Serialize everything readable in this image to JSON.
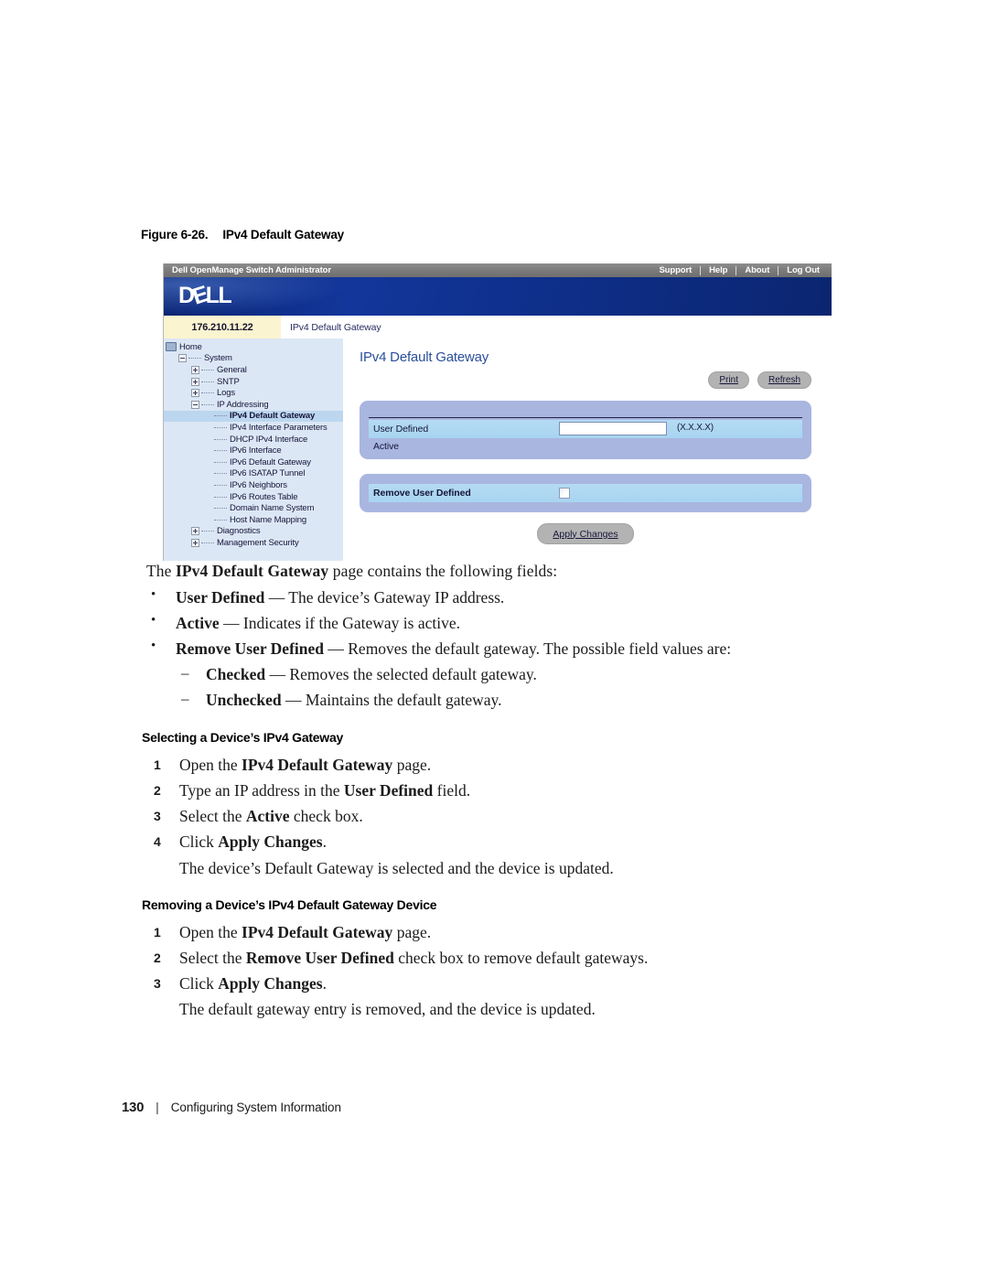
{
  "figure": {
    "number": "Figure 6-26.",
    "title": "IPv4 Default Gateway"
  },
  "screenshot": {
    "titlebar": {
      "app_title": "Dell OpenManage Switch Administrator",
      "nav": [
        {
          "label": "Support"
        },
        {
          "label": "Help"
        },
        {
          "label": "About"
        },
        {
          "label": "Log Out"
        }
      ]
    },
    "banner": {
      "logo_text": "DELL",
      "logo_part_1": "D",
      "logo_part_2": "E",
      "logo_part_3": "LL"
    },
    "breadcrumb": {
      "ip_address": "176.210.11.22",
      "page_name": "IPv4 Default Gateway"
    },
    "tree": [
      {
        "label": "Home",
        "indent": 0,
        "node": "folder",
        "selected": false
      },
      {
        "label": "System",
        "indent": 1,
        "node": "minus",
        "selected": false
      },
      {
        "label": "General",
        "indent": 2,
        "node": "plus",
        "selected": false
      },
      {
        "label": "SNTP",
        "indent": 2,
        "node": "plus",
        "selected": false
      },
      {
        "label": "Logs",
        "indent": 2,
        "node": "plus",
        "selected": false
      },
      {
        "label": "IP Addressing",
        "indent": 2,
        "node": "minus",
        "selected": false
      },
      {
        "label": "IPv4 Default Gateway",
        "indent": 3,
        "node": "leaf",
        "selected": true
      },
      {
        "label": "IPv4 Interface Parameters",
        "indent": 3,
        "node": "leaf",
        "selected": false
      },
      {
        "label": "DHCP IPv4 Interface",
        "indent": 3,
        "node": "leaf",
        "selected": false
      },
      {
        "label": "IPv6 Interface",
        "indent": 3,
        "node": "leaf",
        "selected": false
      },
      {
        "label": "IPv6 Default Gateway",
        "indent": 3,
        "node": "leaf",
        "selected": false
      },
      {
        "label": "IPv6 ISATAP Tunnel",
        "indent": 3,
        "node": "leaf",
        "selected": false
      },
      {
        "label": "IPv6 Neighbors",
        "indent": 3,
        "node": "leaf",
        "selected": false
      },
      {
        "label": "IPv6 Routes Table",
        "indent": 3,
        "node": "leaf",
        "selected": false
      },
      {
        "label": "Domain Name System",
        "indent": 3,
        "node": "leaf",
        "selected": false
      },
      {
        "label": "Host Name Mapping",
        "indent": 3,
        "node": "leaf",
        "selected": false
      },
      {
        "label": "Diagnostics",
        "indent": 2,
        "node": "plus",
        "selected": false
      },
      {
        "label": "Management Security",
        "indent": 2,
        "node": "plus",
        "selected": false
      }
    ],
    "main": {
      "heading": "IPv4 Default Gateway",
      "print_label": "Print",
      "refresh_label": "Refresh",
      "fields": {
        "user_defined_label": "User Defined",
        "user_defined_value": "",
        "user_defined_hint": "(X.X.X.X)",
        "active_label": "Active",
        "remove_user_defined_label": "Remove User Defined",
        "remove_user_defined_checked": false
      },
      "apply_label": "Apply Changes"
    }
  },
  "body": {
    "intro_1": "The ",
    "intro_bold": "IPv4 Default Gateway",
    "intro_2": " page contains the following fields:",
    "bullets": [
      {
        "marker": "•",
        "bold": "User Defined",
        "rest": " — The device’s Gateway IP address."
      },
      {
        "marker": "•",
        "bold": "Active",
        "rest": " — Indicates if the Gateway is active."
      },
      {
        "marker": "•",
        "bold": "Remove User Defined",
        "rest": " — Removes the default gateway. The possible field values are:"
      },
      {
        "marker": "–",
        "bold": "Checked",
        "rest": " — Removes the selected default gateway."
      },
      {
        "marker": "–",
        "bold": "Unchecked",
        "rest": " — Maintains the default gateway."
      }
    ],
    "section_1": {
      "heading": "Selecting a Device’s IPv4 Gateway",
      "steps": [
        {
          "num": "1",
          "pre": "Open the ",
          "bold": "IPv4 Default Gateway",
          "post": " page."
        },
        {
          "num": "2",
          "pre": "Type an IP address in the ",
          "bold": "User Defined",
          "post": " field."
        },
        {
          "num": "3",
          "pre": "Select the ",
          "bold": "Active",
          "post": " check box."
        },
        {
          "num": "4",
          "pre": "Click ",
          "bold": "Apply Changes",
          "post": "."
        }
      ],
      "result": "The device’s Default Gateway is selected and the device is updated."
    },
    "section_2": {
      "heading": "Removing a Device’s IPv4 Default Gateway Device",
      "steps": [
        {
          "num": "1",
          "pre": "Open the ",
          "bold": "IPv4 Default Gateway",
          "post": " page."
        },
        {
          "num": "2",
          "pre": "Select the ",
          "bold": "Remove User Defined",
          "post": " check box to remove default gateways."
        },
        {
          "num": "3",
          "pre": "Click ",
          "bold": "Apply Changes",
          "post": "."
        }
      ],
      "result": "The default gateway entry is removed, and the device is updated."
    }
  },
  "footer": {
    "page_number": "130",
    "separator": "|",
    "chapter": "Configuring System Information"
  },
  "colors": {
    "dell_blue": "#0d2e8f",
    "tree_bg": "#dce7f5",
    "tree_selected": "#bcd6ef",
    "panel_bg": "#a9b6e0",
    "row_bg": "#a8d4f0",
    "crumb_yellow": "#fbf4d0",
    "heading_blue": "#2b4f9c",
    "button_gray": "#b3b3b3"
  }
}
